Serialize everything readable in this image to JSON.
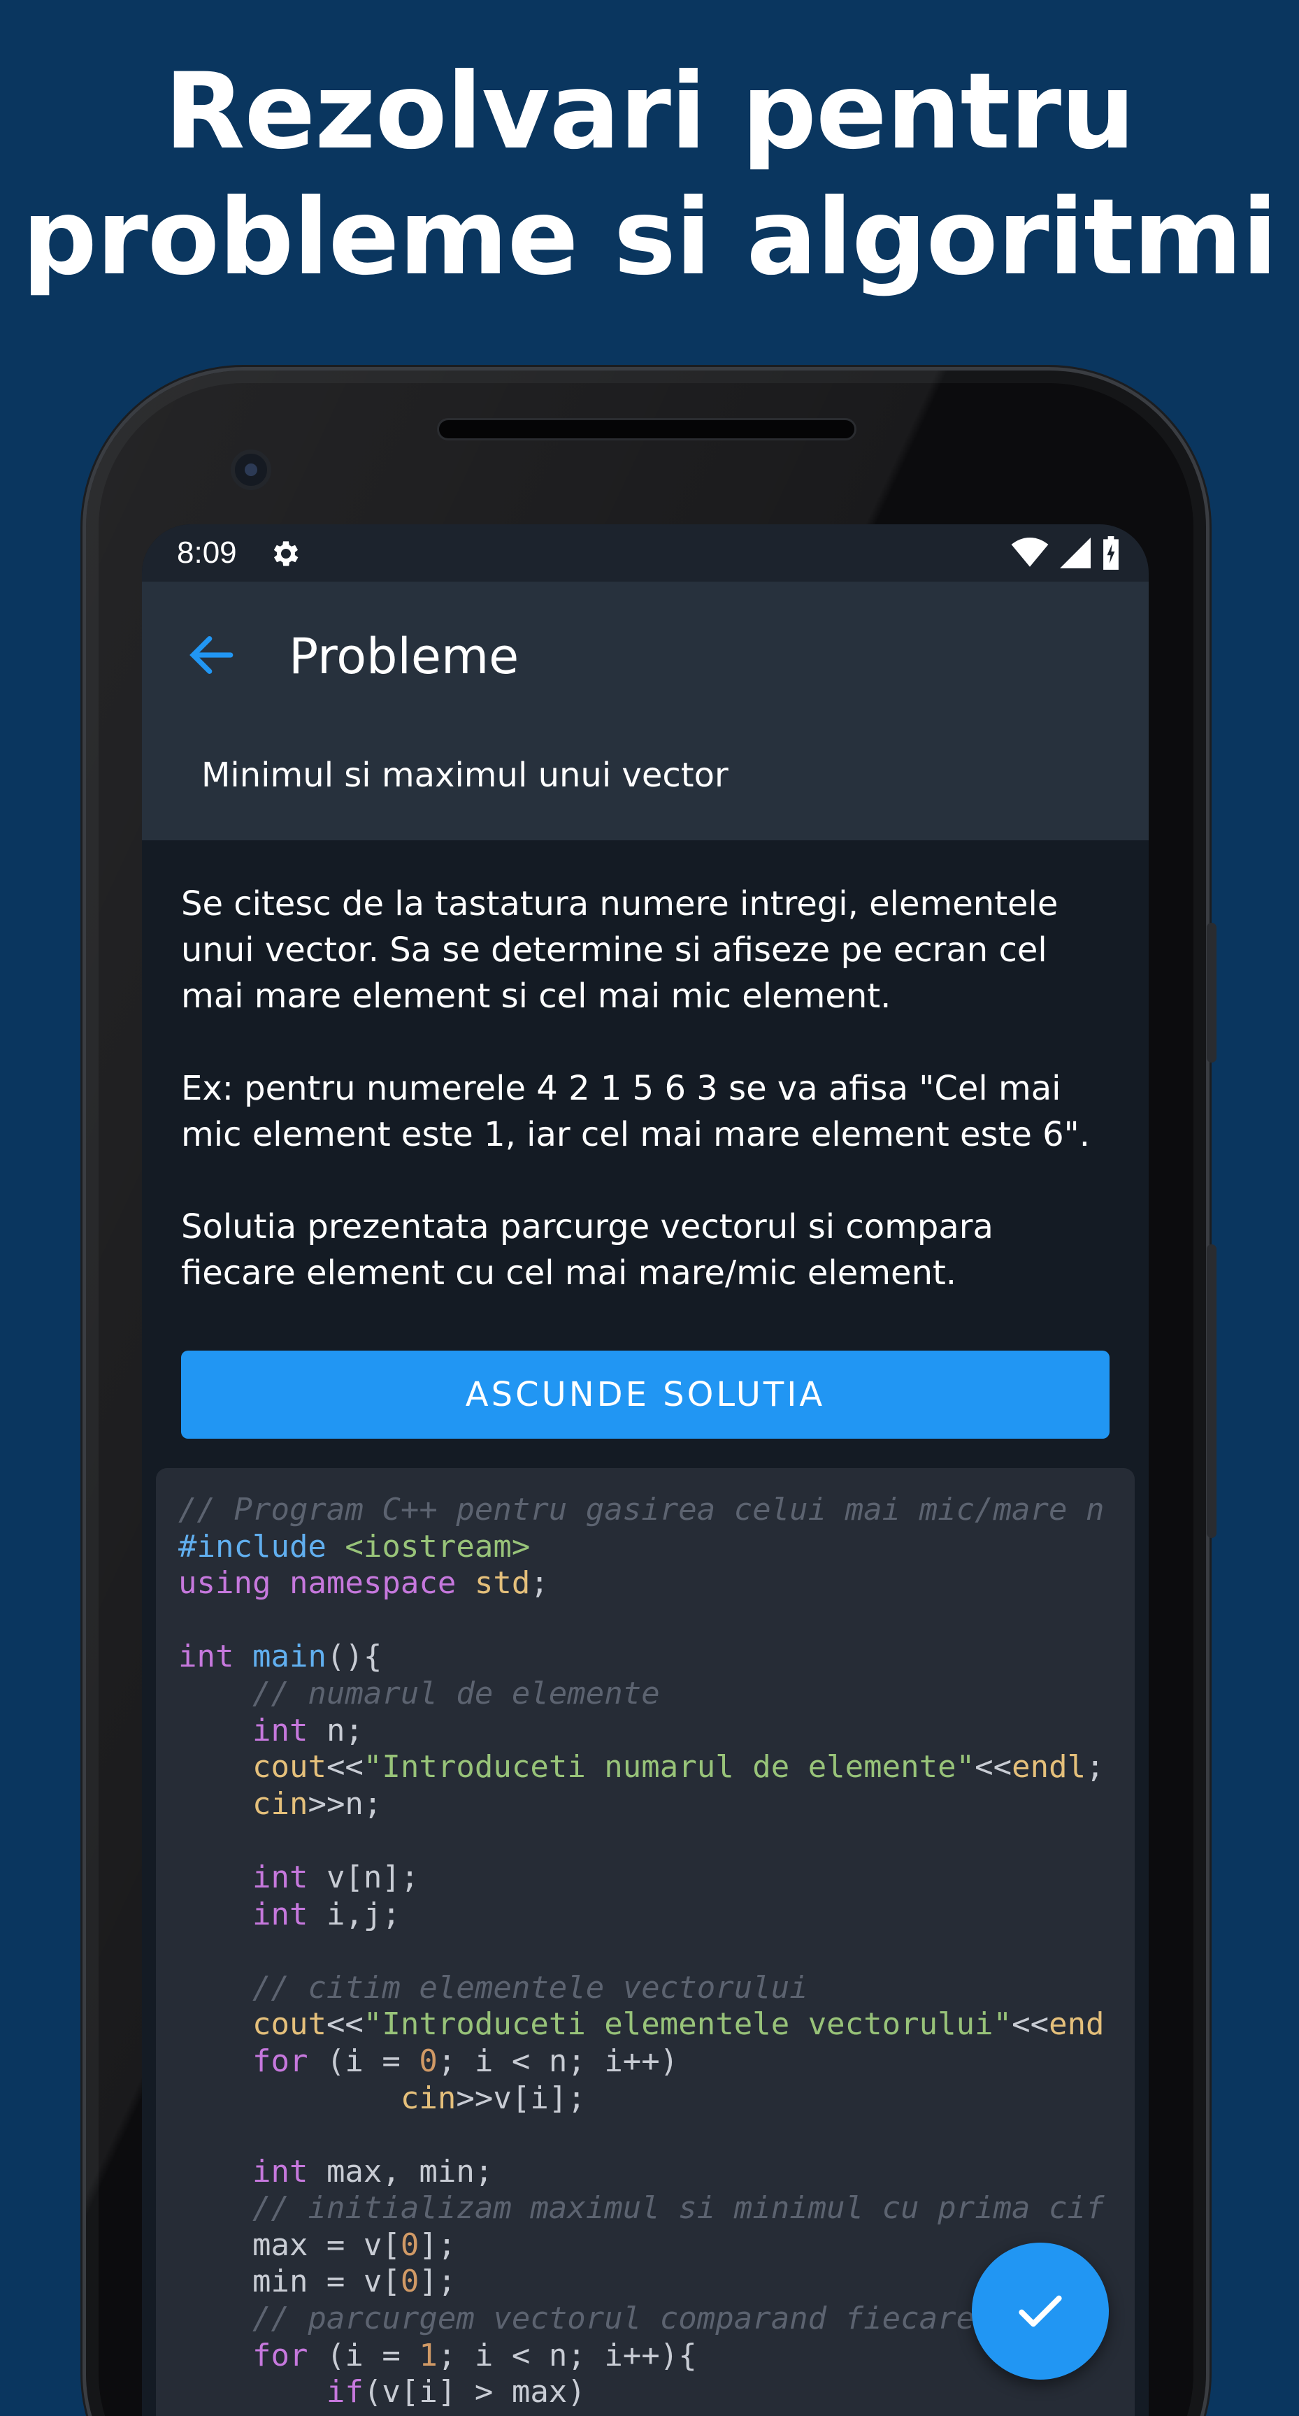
{
  "headline": {
    "line1": "Rezolvari pentru",
    "line2": "probleme si algoritmi"
  },
  "status_bar": {
    "time": "8:09",
    "icons": [
      "settings-icon",
      "wifi-icon",
      "signal-icon",
      "battery-charging-icon"
    ]
  },
  "app_bar": {
    "title": "Probleme",
    "back_icon": "arrow-left-icon"
  },
  "problem": {
    "title": "Minimul si maximul unui vector",
    "description": [
      "Se citesc de la tastatura numere intregi, elementele unui vector. Sa se determine si afiseze pe ecran cel mai mare element si cel mai mic element.",
      "Ex: pentru numerele 4 2 1 5 6 3 se va afisa \"Cel mai mic element este 1, iar cel mai mare element este 6\".",
      "Solutia prezentata parcurge vectorul si compara fiecare element cu cel mai mare/mic element."
    ]
  },
  "solution_button": {
    "label": "ASCUNDE SOLUTIA"
  },
  "code": {
    "language": "C++",
    "lines": [
      "// Program C++ pentru gasirea celui mai mic/mare n",
      "#include <iostream>",
      "using namespace std;",
      "",
      "int main(){",
      "    // numarul de elemente",
      "    int n;",
      "    cout<<\"Introduceti numarul de elemente\"<<endl;",
      "    cin>>n;",
      "",
      "    int v[n];",
      "    int i,j;",
      "",
      "    // citim elementele vectorului",
      "    cout<<\"Introduceti elementele vectorului\"<<end",
      "    for (i = 0; i < n; i++)",
      "            cin>>v[i];",
      "",
      "    int max, min;",
      "    // initializam maximul si minimul cu prima cif",
      "    max = v[0];",
      "    min = v[0];",
      "    // parcurgem vectorul comparand fiecare e",
      "    for (i = 1; i < n; i++){",
      "        if(v[i] > max)"
    ]
  },
  "fab": {
    "icon": "check-icon"
  },
  "colors": {
    "background": "#0a365f",
    "accent": "#2196f3",
    "app_bar": "#27313d",
    "content": "#141b24",
    "code_bg": "#262c36"
  }
}
